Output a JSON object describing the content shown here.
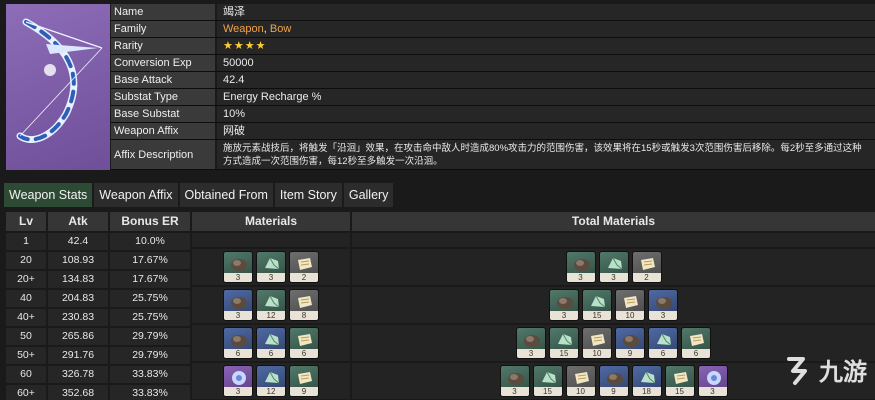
{
  "info": [
    {
      "key": "Name",
      "value": "竭泽"
    },
    {
      "key": "Family",
      "value_parts": [
        "Weapon",
        ", ",
        "Bow"
      ]
    },
    {
      "key": "Rarity",
      "value": "★★★★",
      "stars": 4
    },
    {
      "key": "Conversion Exp",
      "value": "50000"
    },
    {
      "key": "Base Attack",
      "value": "42.4"
    },
    {
      "key": "Substat Type",
      "value": "Energy Recharge %"
    },
    {
      "key": "Base Substat",
      "value": "10%"
    },
    {
      "key": "Weapon Affix",
      "value": "网破"
    },
    {
      "key": "Affix Description",
      "value": "施放元素战技后，将触发「沿洄」效果，在攻击命中敌人时造成80%攻击力的范围伤害，该效果将在15秒或触发3次范围伤害后移除。每2秒至多通过这种方式造成一次范围伤害，每12秒至多触发一次沿洄。"
    }
  ],
  "tabs": [
    "Weapon Stats",
    "Weapon Affix",
    "Obtained From",
    "Item Story",
    "Gallery"
  ],
  "active_tab": "Weapon Stats",
  "table": {
    "headers": {
      "lv": "Lv",
      "atk": "Atk",
      "er": "Bonus ER",
      "materials": "Materials",
      "total": "Total Materials"
    },
    "rows": [
      {
        "lv": "1",
        "atk": "42.4",
        "er": "10.0%"
      },
      {
        "lv": "20",
        "atk": "108.93",
        "er": "17.67%"
      },
      {
        "lv": "20+",
        "atk": "134.83",
        "er": "17.67%"
      },
      {
        "lv": "40",
        "atk": "204.83",
        "er": "25.75%"
      },
      {
        "lv": "40+",
        "atk": "230.83",
        "er": "25.75%"
      },
      {
        "lv": "50",
        "atk": "265.86",
        "er": "29.79%"
      },
      {
        "lv": "50+",
        "atk": "291.76",
        "er": "29.79%"
      },
      {
        "lv": "60",
        "atk": "326.78",
        "er": "33.83%"
      },
      {
        "lv": "60+",
        "atk": "352.68",
        "er": "33.83%"
      }
    ],
    "materials": [
      [
        {
          "n": "3",
          "r": "r2",
          "icon": "fish-scale-icon"
        },
        {
          "n": "3",
          "r": "r2",
          "icon": "ore-icon"
        },
        {
          "n": "2",
          "r": "r1",
          "icon": "scroll-icon"
        }
      ],
      [
        {
          "n": "3",
          "r": "r3",
          "icon": "fish-scale-icon"
        },
        {
          "n": "12",
          "r": "r2",
          "icon": "ore-icon"
        },
        {
          "n": "8",
          "r": "r1",
          "icon": "scroll-icon"
        }
      ],
      [
        {
          "n": "6",
          "r": "r3",
          "icon": "fish-scale-icon"
        },
        {
          "n": "6",
          "r": "r3",
          "icon": "ore-icon"
        },
        {
          "n": "6",
          "r": "r2",
          "icon": "scroll-icon"
        }
      ],
      [
        {
          "n": "3",
          "r": "r4",
          "icon": "gem-icon"
        },
        {
          "n": "12",
          "r": "r3",
          "icon": "ore-icon"
        },
        {
          "n": "9",
          "r": "r2",
          "icon": "scroll-icon"
        }
      ]
    ],
    "totals": [
      [
        {
          "n": "3",
          "r": "r2",
          "icon": "fish-scale-icon"
        },
        {
          "n": "3",
          "r": "r2",
          "icon": "ore-icon"
        },
        {
          "n": "2",
          "r": "r1",
          "icon": "scroll-icon"
        }
      ],
      [
        {
          "n": "3",
          "r": "r2",
          "icon": "fish-scale-icon"
        },
        {
          "n": "15",
          "r": "r2",
          "icon": "ore-icon"
        },
        {
          "n": "10",
          "r": "r1",
          "icon": "scroll-icon"
        },
        {
          "n": "3",
          "r": "r3",
          "icon": "fish-scale-icon"
        }
      ],
      [
        {
          "n": "3",
          "r": "r2",
          "icon": "fish-scale-icon"
        },
        {
          "n": "15",
          "r": "r2",
          "icon": "ore-icon"
        },
        {
          "n": "10",
          "r": "r1",
          "icon": "scroll-icon"
        },
        {
          "n": "9",
          "r": "r3",
          "icon": "fish-scale-icon"
        },
        {
          "n": "6",
          "r": "r3",
          "icon": "ore-icon"
        },
        {
          "n": "6",
          "r": "r2",
          "icon": "scroll-icon"
        }
      ],
      [
        {
          "n": "3",
          "r": "r2",
          "icon": "fish-scale-icon"
        },
        {
          "n": "15",
          "r": "r2",
          "icon": "ore-icon"
        },
        {
          "n": "10",
          "r": "r1",
          "icon": "scroll-icon"
        },
        {
          "n": "9",
          "r": "r3",
          "icon": "fish-scale-icon"
        },
        {
          "n": "18",
          "r": "r3",
          "icon": "ore-icon"
        },
        {
          "n": "15",
          "r": "r2",
          "icon": "scroll-icon"
        },
        {
          "n": "3",
          "r": "r4",
          "icon": "gem-icon"
        }
      ]
    ]
  },
  "watermark": {
    "text": "九游"
  },
  "colors": {
    "accent_orange": "#f0a347",
    "star": "#ffcc33",
    "active_tab": "#2d4a34"
  }
}
